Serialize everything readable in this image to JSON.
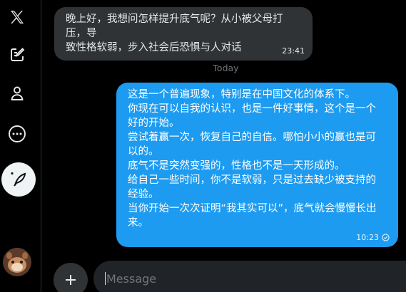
{
  "sidebar": {
    "icons": [
      "x-logo-icon",
      "compose-post-icon",
      "profile-icon",
      "more-icon",
      "grok-compose-icon",
      "avatar"
    ]
  },
  "conversation": {
    "incoming": {
      "text": "晚上好，我想问怎样提升底气呢？从小被父母打压，导\n致性格软弱，步入社会后恐惧与人对话",
      "time": "23:41"
    },
    "day_divider": "Today",
    "outgoing": {
      "text": "这是一个普遍现象，特别是在中国文化的体系下。\n你现在可以自我的认识，也是一件好事情，这个是一个\n好的开始。\n尝试着赢一次，恢复自己的自信。哪怕小小的赢也是可\n以的。\n底气不是突然变强的，性格也不是一天形成的。\n给自己一些时间，你不是软弱，只是过去缺少被支持的\n经验。\n当你开始一次次证明“我其实可以”，底气就会慢慢长出\n来。",
      "time": "10:23"
    }
  },
  "composer": {
    "placeholder": "Message"
  },
  "colors": {
    "background": "#000000",
    "incoming_bubble": "#2f3336",
    "outgoing_bubble": "#1d9bf0",
    "muted_text": "#71767b"
  }
}
